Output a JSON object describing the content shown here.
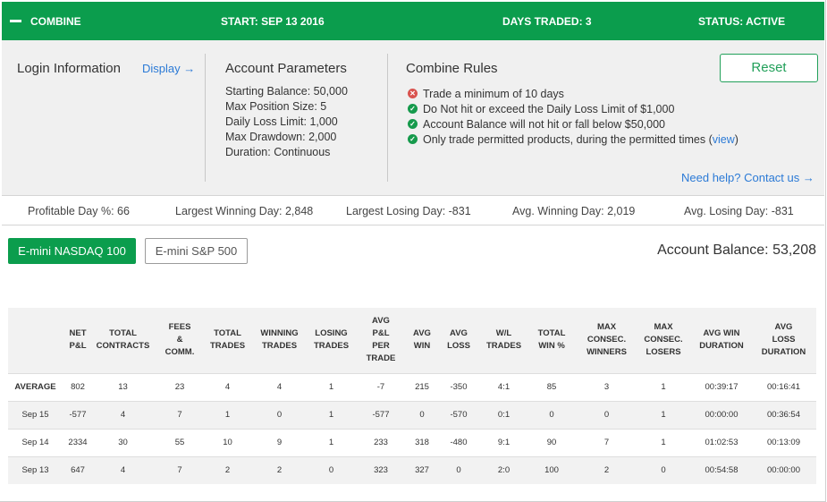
{
  "header": {
    "collapse_icon": "minus-icon",
    "title": "COMBINE",
    "start": "START: SEP 13 2016",
    "days_traded": "DAYS TRADED: 3",
    "status": "STATUS: ACTIVE",
    "color": "#0b9d4d"
  },
  "login": {
    "title": "Login Information",
    "display_link": "Display →"
  },
  "account_parameters": {
    "title": "Account Parameters",
    "items": [
      "Starting Balance: 50,000",
      "Max Position Size: 5",
      "Daily Loss Limit: 1,000",
      "Max Drawdown: 2,000",
      "Duration: Continuous"
    ]
  },
  "combine_rules": {
    "title": "Combine Rules",
    "rules": [
      {
        "text": "Trade a minimum of 10 days",
        "icon": "x-circle-icon",
        "status": "fail"
      },
      {
        "text": "Do Not hit or exceed the Daily Loss Limit of $1,000",
        "icon": "check-circle-icon",
        "status": "pass"
      },
      {
        "text": "Account Balance will not hit or fall below $50,000",
        "icon": "check-circle-icon",
        "status": "pass"
      },
      {
        "text": "Only trade permitted products, during the permitted times (",
        "link": "view",
        "tail": ")",
        "icon": "check-circle-icon",
        "status": "pass"
      }
    ],
    "help_link": "Need help? Contact us →"
  },
  "reset_button": "Reset",
  "stats": [
    "Profitable Day %: 66",
    "Largest Winning Day: 2,848",
    "Largest Losing Day: -831",
    "Avg. Winning Day: 2,019",
    "Avg. Losing Day: -831"
  ],
  "tabs": [
    {
      "label": "E-mini NASDAQ 100",
      "active": true
    },
    {
      "label": "E-mini S&P 500",
      "active": false
    }
  ],
  "account_balance": "Account Balance: 53,208",
  "table": {
    "columns": [
      "",
      "NET P&L",
      "TOTAL CONTRACTS",
      "FEES & COMM.",
      "TOTAL TRADES",
      "WINNING TRADES",
      "LOSING TRADES",
      "AVG P&L PER TRADE",
      "AVG WIN",
      "AVG LOSS",
      "W/L TRADES",
      "TOTAL WIN %",
      "MAX CONSEC. WINNERS",
      "MAX CONSEC. LOSERS",
      "AVG WIN DURATION",
      "AVG LOSS DURATION"
    ],
    "rows": [
      [
        "AVERAGE",
        "802",
        "13",
        "23",
        "4",
        "4",
        "1",
        "-7",
        "215",
        "-350",
        "4:1",
        "85",
        "3",
        "1",
        "00:39:17",
        "00:16:41"
      ],
      [
        "Sep 15",
        "-577",
        "4",
        "7",
        "1",
        "0",
        "1",
        "-577",
        "0",
        "-570",
        "0:1",
        "0",
        "0",
        "1",
        "00:00:00",
        "00:36:54"
      ],
      [
        "Sep 14",
        "2334",
        "30",
        "55",
        "10",
        "9",
        "1",
        "233",
        "318",
        "-480",
        "9:1",
        "90",
        "7",
        "1",
        "01:02:53",
        "00:13:09"
      ],
      [
        "Sep 13",
        "647",
        "4",
        "7",
        "2",
        "2",
        "0",
        "323",
        "327",
        "0",
        "2:0",
        "100",
        "2",
        "0",
        "00:54:58",
        "00:00:00"
      ]
    ]
  }
}
